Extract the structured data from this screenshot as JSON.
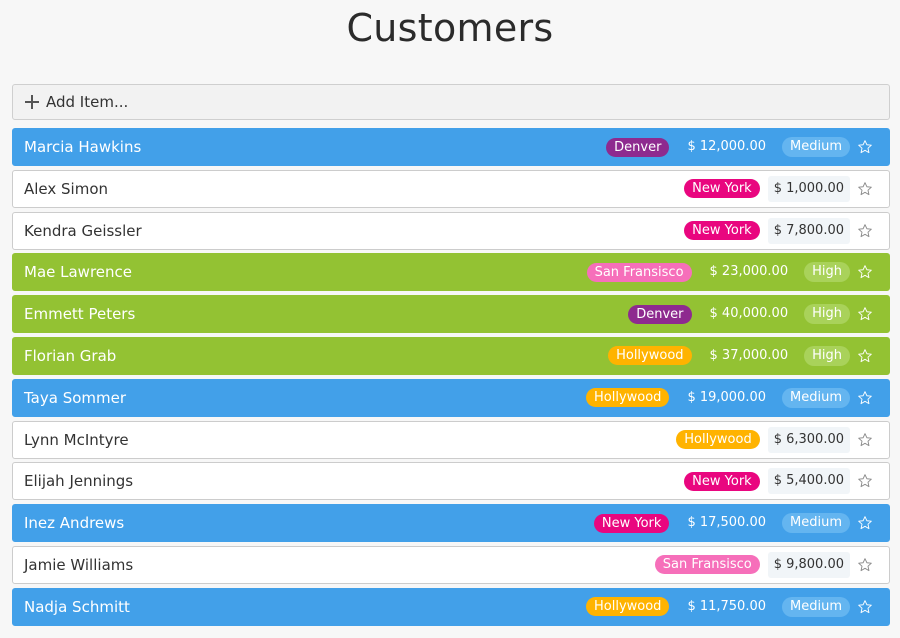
{
  "page": {
    "title": "Customers"
  },
  "add_item": {
    "label": "Add Item..."
  },
  "colors": {
    "city_denver": "#8e2a8f",
    "city_new_york": "#e9067f",
    "city_san_fransisco": "#f66fba",
    "city_hollywood": "#ffb300"
  },
  "customers": [
    {
      "name": "Marcia Hawkins",
      "city": "Denver",
      "amount": "$ 12,000.00",
      "priority": "Medium",
      "style": "blue"
    },
    {
      "name": "Alex Simon",
      "city": "New York",
      "amount": "$ 1,000.00",
      "priority": "",
      "style": "white"
    },
    {
      "name": "Kendra Geissler",
      "city": "New York",
      "amount": "$ 7,800.00",
      "priority": "",
      "style": "white"
    },
    {
      "name": "Mae Lawrence",
      "city": "San Fransisco",
      "amount": "$ 23,000.00",
      "priority": "High",
      "style": "green"
    },
    {
      "name": "Emmett Peters",
      "city": "Denver",
      "amount": "$ 40,000.00",
      "priority": "High",
      "style": "green"
    },
    {
      "name": "Florian Grab",
      "city": "Hollywood",
      "amount": "$ 37,000.00",
      "priority": "High",
      "style": "green"
    },
    {
      "name": "Taya Sommer",
      "city": "Hollywood",
      "amount": "$ 19,000.00",
      "priority": "Medium",
      "style": "blue"
    },
    {
      "name": "Lynn McIntyre",
      "city": "Hollywood",
      "amount": "$ 6,300.00",
      "priority": "",
      "style": "white"
    },
    {
      "name": "Elijah Jennings",
      "city": "New York",
      "amount": "$ 5,400.00",
      "priority": "",
      "style": "white"
    },
    {
      "name": "Inez Andrews",
      "city": "New York",
      "amount": "$ 17,500.00",
      "priority": "Medium",
      "style": "blue"
    },
    {
      "name": "Jamie Williams",
      "city": "San Fransisco",
      "amount": "$ 9,800.00",
      "priority": "",
      "style": "white"
    },
    {
      "name": "Nadja Schmitt",
      "city": "Hollywood",
      "amount": "$ 11,750.00",
      "priority": "Medium",
      "style": "blue"
    }
  ]
}
